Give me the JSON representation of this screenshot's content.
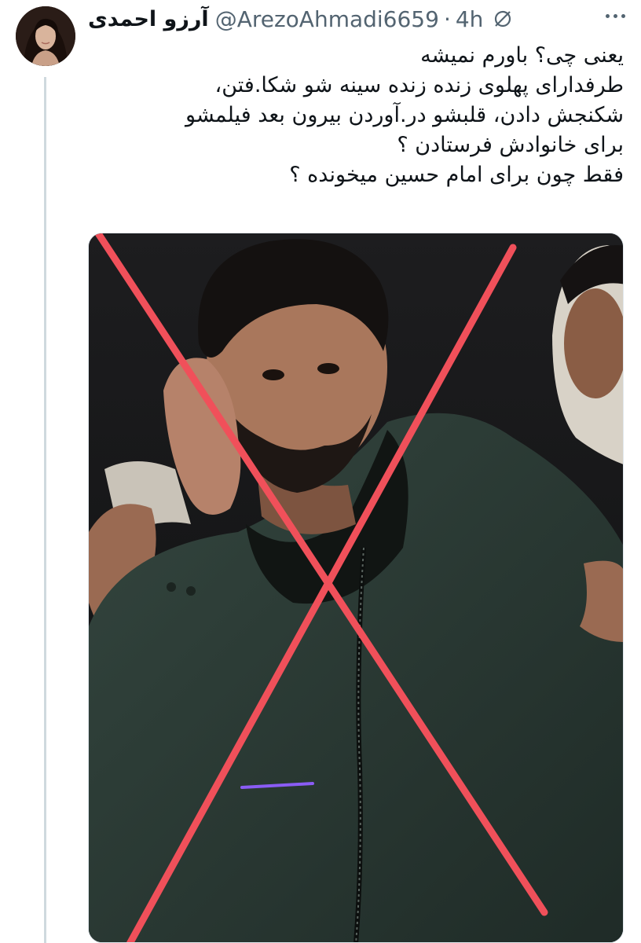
{
  "tweet": {
    "display_name": "آرزو احمدی",
    "handle": "@ArezoAhmadi6659",
    "separator": "·",
    "time": "4h",
    "hidden_icon": "eye-slash-icon",
    "more_icon": "more-dots-icon",
    "text_lines": [
      "یعنی چی؟ باورم نمیشه",
      "طرفدارای پهلوی زنده زنده سینه شو شکا.فتن،",
      "شکنجش دادن، قلبشو در.آوردن بیرون بعد فیلمشو",
      "برای خانوادش فرستادن ؟",
      "فقط چون برای امام حسین میخونده ؟"
    ]
  },
  "media": {
    "description_icon": "photo-crossed-out",
    "overlay_color": "#f0505a",
    "underline_color": "#8a5cf5",
    "jacket_color": "#2b3a35",
    "background_color": "#151617"
  },
  "colors": {
    "text_primary": "#0f1419",
    "text_secondary": "#536471",
    "thread_line": "#cfd9de"
  }
}
